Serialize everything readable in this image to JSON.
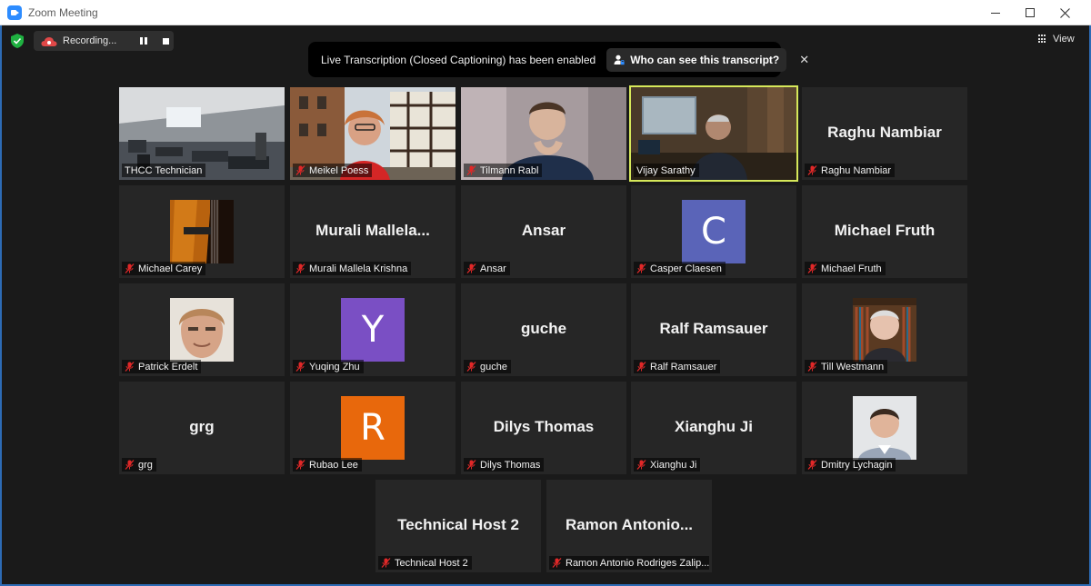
{
  "window": {
    "title": "Zoom Meeting"
  },
  "recording": {
    "label": "Recording..."
  },
  "view": {
    "label": "View"
  },
  "banner": {
    "message": "Live Transcription (Closed Captioning) has been enabled",
    "button_label": "Who can see this transcript?"
  },
  "participants": [
    {
      "name": "THCC Technician",
      "display": "",
      "tile": "video",
      "muted": false
    },
    {
      "name": "Meikel Poess",
      "display": "",
      "tile": "video",
      "muted": true
    },
    {
      "name": "Tilmann Rabl",
      "display": "",
      "tile": "video",
      "muted": true
    },
    {
      "name": "Vijay Sarathy",
      "display": "",
      "tile": "video",
      "muted": false,
      "active_speaker": true
    },
    {
      "name": "Raghu Nambiar",
      "display": "Raghu Nambiar",
      "tile": "name",
      "muted": true
    },
    {
      "name": "Michael Carey",
      "display": "",
      "tile": "photo",
      "muted": true
    },
    {
      "name": "Murali Mallela Krishna",
      "display": "Murali  Mallela...",
      "tile": "name",
      "muted": true
    },
    {
      "name": "Ansar",
      "display": "Ansar",
      "tile": "name",
      "muted": true
    },
    {
      "name": "Casper Claesen",
      "display": "C",
      "tile": "avatar",
      "avatar_color": "#5a64b8",
      "muted": true
    },
    {
      "name": "Michael Fruth",
      "display": "Michael Fruth",
      "tile": "name",
      "muted": true
    },
    {
      "name": "Patrick Erdelt",
      "display": "",
      "tile": "photo",
      "muted": true
    },
    {
      "name": "Yuqing Zhu",
      "display": "Y",
      "tile": "avatar",
      "avatar_color": "#7a4fc4",
      "muted": true
    },
    {
      "name": "guche",
      "display": "guche",
      "tile": "name",
      "muted": true
    },
    {
      "name": "Ralf Ramsauer",
      "display": "Ralf Ramsauer",
      "tile": "name",
      "muted": true
    },
    {
      "name": "Till Westmann",
      "display": "",
      "tile": "photo",
      "muted": true
    },
    {
      "name": "grg",
      "display": "grg",
      "tile": "name",
      "muted": true
    },
    {
      "name": "Rubao Lee",
      "display": "R",
      "tile": "avatar",
      "avatar_color": "#e8680c",
      "muted": true
    },
    {
      "name": "Dilys Thomas",
      "display": "Dilys Thomas",
      "tile": "name",
      "muted": true
    },
    {
      "name": "Xianghu Ji",
      "display": "Xianghu Ji",
      "tile": "name",
      "muted": true
    },
    {
      "name": "Dmitry Lychagin",
      "display": "",
      "tile": "photo",
      "muted": true
    },
    {
      "name": "Technical Host 2",
      "display": "Technical Host 2",
      "tile": "name",
      "muted": true
    },
    {
      "name": "Ramon Antonio Rodriges Zalip...",
      "display": "Ramon  Antonio...",
      "tile": "name",
      "muted": true
    }
  ],
  "colors": {
    "accent": "#2d8cff",
    "active_speaker": "#d6e85a",
    "muted_icon": "#e02828",
    "background": "#1a1a1a"
  }
}
